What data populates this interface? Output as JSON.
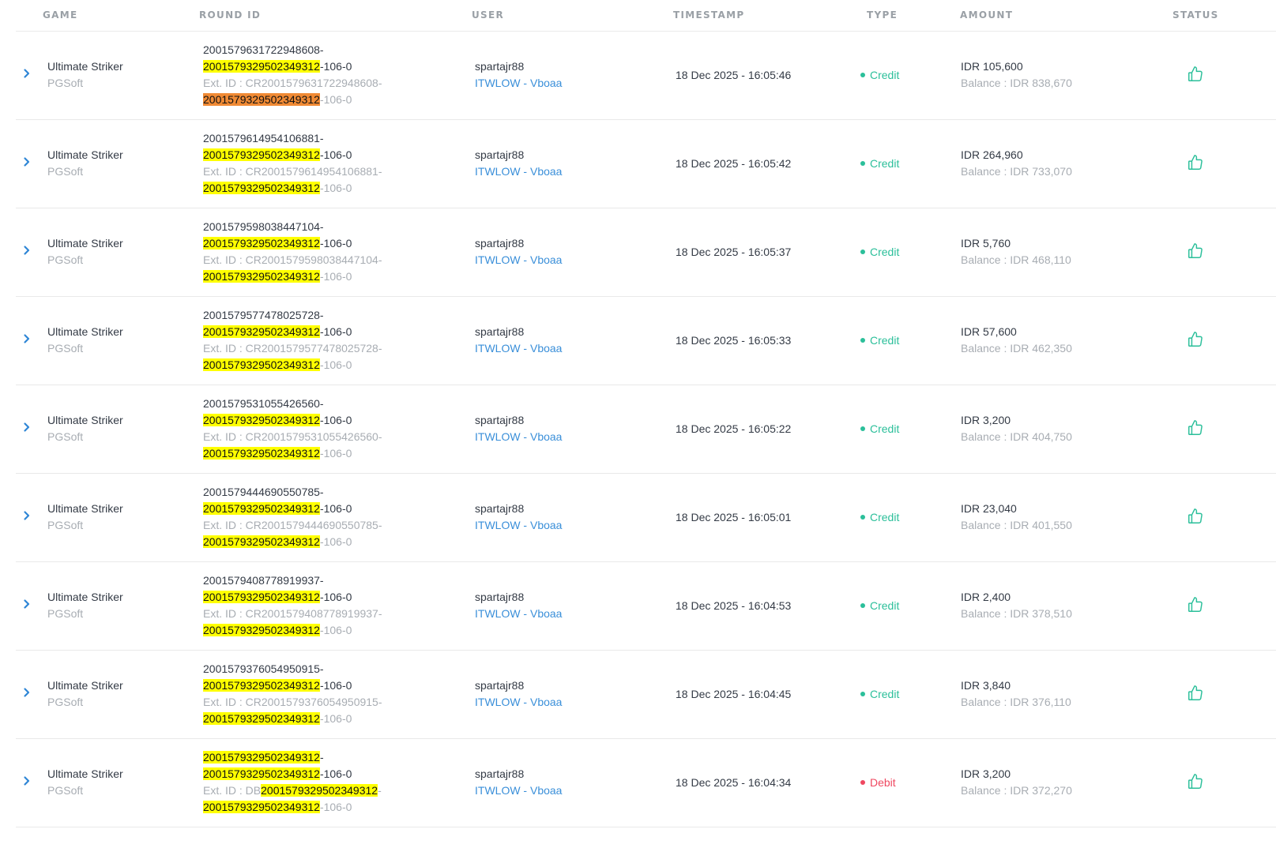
{
  "header": {
    "game": "GAME",
    "round_id": "ROUND ID",
    "user": "USER",
    "timestamp": "TIMESTAMP",
    "type": "TYPE",
    "amount": "AMOUNT",
    "status": "STATUS"
  },
  "colors": {
    "credit": "#2bbf9a",
    "debit": "#ef4860",
    "link": "#3a8fd9",
    "highlight_yellow": "#ffff00",
    "highlight_orange": "#f08a34",
    "status_icon": "#2bbf9a"
  },
  "icons": {
    "expand": "chevron-right-icon",
    "status": "thumbs-up-icon"
  },
  "rows": [
    {
      "game": "Ultimate Striker",
      "provider": "PGSoft",
      "r1a": "2001579631722948608-",
      "r1hl": "",
      "r2hl": "2001579329502349312",
      "r2b": "-106-0",
      "r3a": "Ext. ID : CR2001579631722948608-",
      "r3hl": "",
      "r3b": "",
      "r4hl": "2001579329502349312",
      "r4b": "-106-0",
      "r4orange": true,
      "user": "spartajr88",
      "link": "ITWLOW - Vboaa",
      "timestamp": "18 Dec 2025 - 16:05:46",
      "type": "Credit",
      "amount": "IDR 105,600",
      "balance": "Balance : IDR 838,670"
    },
    {
      "game": "Ultimate Striker",
      "provider": "PGSoft",
      "r1a": "2001579614954106881-",
      "r1hl": "",
      "r2hl": "2001579329502349312",
      "r2b": "-106-0",
      "r3a": "Ext. ID : CR2001579614954106881-",
      "r3hl": "",
      "r3b": "",
      "r4hl": "2001579329502349312",
      "r4b": "-106-0",
      "r4orange": false,
      "user": "spartajr88",
      "link": "ITWLOW - Vboaa",
      "timestamp": "18 Dec 2025 - 16:05:42",
      "type": "Credit",
      "amount": "IDR 264,960",
      "balance": "Balance : IDR 733,070"
    },
    {
      "game": "Ultimate Striker",
      "provider": "PGSoft",
      "r1a": "2001579598038447104-",
      "r1hl": "",
      "r2hl": "2001579329502349312",
      "r2b": "-106-0",
      "r3a": "Ext. ID : CR2001579598038447104-",
      "r3hl": "",
      "r3b": "",
      "r4hl": "2001579329502349312",
      "r4b": "-106-0",
      "r4orange": false,
      "user": "spartajr88",
      "link": "ITWLOW - Vboaa",
      "timestamp": "18 Dec 2025 - 16:05:37",
      "type": "Credit",
      "amount": "IDR 5,760",
      "balance": "Balance : IDR 468,110"
    },
    {
      "game": "Ultimate Striker",
      "provider": "PGSoft",
      "r1a": "2001579577478025728-",
      "r1hl": "",
      "r2hl": "2001579329502349312",
      "r2b": "-106-0",
      "r3a": "Ext. ID : CR2001579577478025728-",
      "r3hl": "",
      "r3b": "",
      "r4hl": "2001579329502349312",
      "r4b": "-106-0",
      "r4orange": false,
      "user": "spartajr88",
      "link": "ITWLOW - Vboaa",
      "timestamp": "18 Dec 2025 - 16:05:33",
      "type": "Credit",
      "amount": "IDR 57,600",
      "balance": "Balance : IDR 462,350"
    },
    {
      "game": "Ultimate Striker",
      "provider": "PGSoft",
      "r1a": "2001579531055426560-",
      "r1hl": "",
      "r2hl": "2001579329502349312",
      "r2b": "-106-0",
      "r3a": "Ext. ID : CR2001579531055426560-",
      "r3hl": "",
      "r3b": "",
      "r4hl": "2001579329502349312",
      "r4b": "-106-0",
      "r4orange": false,
      "user": "spartajr88",
      "link": "ITWLOW - Vboaa",
      "timestamp": "18 Dec 2025 - 16:05:22",
      "type": "Credit",
      "amount": "IDR 3,200",
      "balance": "Balance : IDR 404,750"
    },
    {
      "game": "Ultimate Striker",
      "provider": "PGSoft",
      "r1a": "2001579444690550785-",
      "r1hl": "",
      "r2hl": "2001579329502349312",
      "r2b": "-106-0",
      "r3a": "Ext. ID : CR2001579444690550785-",
      "r3hl": "",
      "r3b": "",
      "r4hl": "2001579329502349312",
      "r4b": "-106-0",
      "r4orange": false,
      "user": "spartajr88",
      "link": "ITWLOW - Vboaa",
      "timestamp": "18 Dec 2025 - 16:05:01",
      "type": "Credit",
      "amount": "IDR 23,040",
      "balance": "Balance : IDR 401,550"
    },
    {
      "game": "Ultimate Striker",
      "provider": "PGSoft",
      "r1a": "2001579408778919937-",
      "r1hl": "",
      "r2hl": "2001579329502349312",
      "r2b": "-106-0",
      "r3a": "Ext. ID : CR2001579408778919937-",
      "r3hl": "",
      "r3b": "",
      "r4hl": "2001579329502349312",
      "r4b": "-106-0",
      "r4orange": false,
      "user": "spartajr88",
      "link": "ITWLOW - Vboaa",
      "timestamp": "18 Dec 2025 - 16:04:53",
      "type": "Credit",
      "amount": "IDR 2,400",
      "balance": "Balance : IDR 378,510"
    },
    {
      "game": "Ultimate Striker",
      "provider": "PGSoft",
      "r1a": "2001579376054950915-",
      "r1hl": "",
      "r2hl": "2001579329502349312",
      "r2b": "-106-0",
      "r3a": "Ext. ID : CR2001579376054950915-",
      "r3hl": "",
      "r3b": "",
      "r4hl": "2001579329502349312",
      "r4b": "-106-0",
      "r4orange": false,
      "user": "spartajr88",
      "link": "ITWLOW - Vboaa",
      "timestamp": "18 Dec 2025 - 16:04:45",
      "type": "Credit",
      "amount": "IDR 3,840",
      "balance": "Balance : IDR 376,110"
    },
    {
      "game": "Ultimate Striker",
      "provider": "PGSoft",
      "r1a": "",
      "r1hl": "2001579329502349312",
      "r1b": "-",
      "r2hl": "2001579329502349312",
      "r2b": "-106-0",
      "r3a": "Ext. ID : DB",
      "r3hl": "2001579329502349312",
      "r3b": "-",
      "r4hl": "2001579329502349312",
      "r4b": "-106-0",
      "r4orange": false,
      "user": "spartajr88",
      "link": "ITWLOW - Vboaa",
      "timestamp": "18 Dec 2025 - 16:04:34",
      "type": "Debit",
      "amount": "IDR 3,200",
      "balance": "Balance : IDR 372,270"
    }
  ]
}
